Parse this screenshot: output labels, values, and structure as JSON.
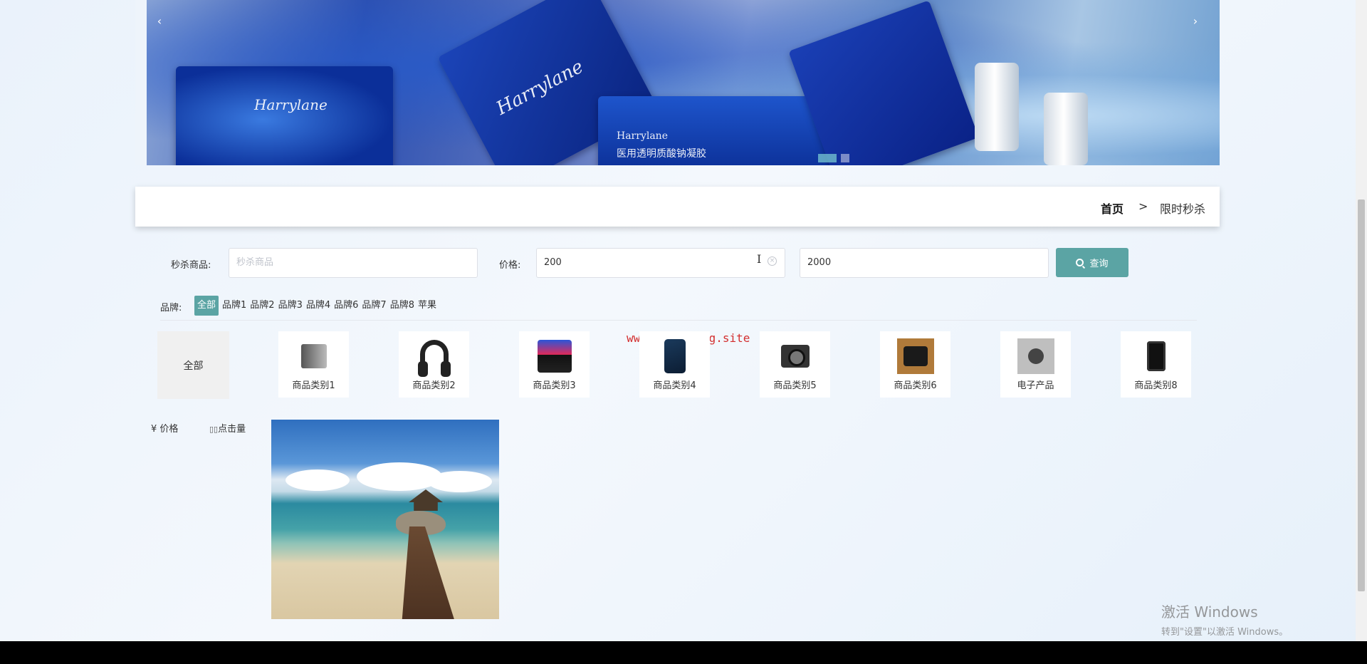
{
  "banner": {
    "brand_text_1": "Harrylane",
    "brand_text_2": "Harrylane",
    "brand_text_3": "Harrylane",
    "product_caption": "医用透明质酸钠凝胶",
    "prev_icon": "‹",
    "next_icon": "›"
  },
  "breadcrumb": {
    "home": "首页",
    "separator": ">",
    "current": "限时秒杀"
  },
  "search": {
    "product_label": "秒杀商品:",
    "product_placeholder": "秒杀商品",
    "price_label": "价格:",
    "price_min": "200",
    "price_max": "2000",
    "button_label": "查询"
  },
  "brand_filter": {
    "label": "品牌:",
    "items": [
      "全部",
      "品牌1",
      "品牌2",
      "品牌3",
      "品牌4",
      "品牌6",
      "品牌7",
      "品牌8",
      "苹果"
    ],
    "active_index": 0
  },
  "watermark": "www.bishebang.site",
  "categories": {
    "all_label": "全部",
    "items": [
      {
        "label": "商品类别1",
        "icon": "desktop-computer-icon"
      },
      {
        "label": "商品类别2",
        "icon": "headphones-icon"
      },
      {
        "label": "商品类别3",
        "icon": "game-controller-icon"
      },
      {
        "label": "商品类别4",
        "icon": "smartphone-icon"
      },
      {
        "label": "商品类别5",
        "icon": "camera-icon"
      },
      {
        "label": "商品类别6",
        "icon": "dslr-camera-icon"
      },
      {
        "label": "电子产品",
        "icon": "electronic-device-icon"
      },
      {
        "label": "商品类别8",
        "icon": "phone-icon"
      }
    ]
  },
  "sort": {
    "price_label": "¥ 价格",
    "click_label": "点击量"
  },
  "windows_activation": {
    "title": "激活 Windows",
    "subtitle": "转到\"设置\"以激活 Windows。"
  },
  "colors": {
    "accent": "#5ba4a4",
    "watermark": "#d32f2f"
  }
}
